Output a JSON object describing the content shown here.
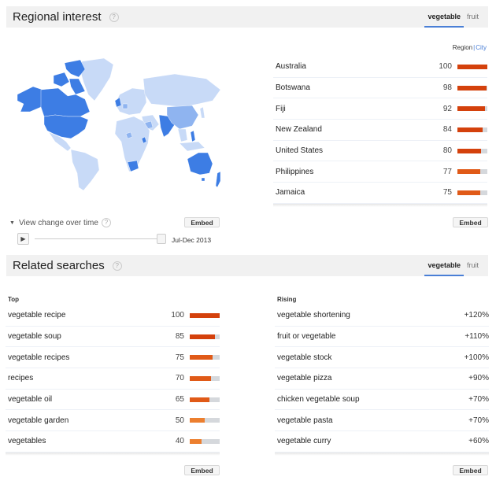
{
  "regional": {
    "title": "Regional interest",
    "help": "?",
    "tabs": [
      {
        "label": "vegetable",
        "active": true
      },
      {
        "label": "fruit",
        "active": false
      }
    ],
    "toggle": {
      "region": "Region",
      "separator": "|",
      "city": "City"
    },
    "rows": [
      {
        "label": "Australia",
        "value": 100
      },
      {
        "label": "Botswana",
        "value": 98
      },
      {
        "label": "Fiji",
        "value": 92
      },
      {
        "label": "New Zealand",
        "value": 84
      },
      {
        "label": "United States",
        "value": 80
      },
      {
        "label": "Philippines",
        "value": 77
      },
      {
        "label": "Jamaica",
        "value": 75
      }
    ],
    "embed": "Embed",
    "map_embed": "Embed",
    "view_change": "View change over time",
    "period": "Jul-Dec 2013",
    "play_icon": "▶",
    "map_colors": {
      "high": "#3d7de4",
      "mid": "#8fb4f0",
      "low": "#c8daf7"
    }
  },
  "related": {
    "title": "Related searches",
    "help": "?",
    "tabs": [
      {
        "label": "vegetable",
        "active": true
      },
      {
        "label": "fruit",
        "active": false
      }
    ],
    "top": {
      "heading": "Top",
      "rows": [
        {
          "label": "vegetable recipe",
          "value": 100
        },
        {
          "label": "vegetable soup",
          "value": 85
        },
        {
          "label": "vegetable recipes",
          "value": 75
        },
        {
          "label": "recipes",
          "value": 70
        },
        {
          "label": "vegetable oil",
          "value": 65
        },
        {
          "label": "vegetable garden",
          "value": 50
        },
        {
          "label": "vegetables",
          "value": 40
        }
      ],
      "embed": "Embed"
    },
    "rising": {
      "heading": "Rising",
      "rows": [
        {
          "label": "vegetable shortening",
          "value": "+120%"
        },
        {
          "label": "fruit or vegetable",
          "value": "+110%"
        },
        {
          "label": "vegetable stock",
          "value": "+100%"
        },
        {
          "label": "vegetable pizza",
          "value": "+90%"
        },
        {
          "label": "chicken vegetable soup",
          "value": "+70%"
        },
        {
          "label": "vegetable pasta",
          "value": "+70%"
        },
        {
          "label": "vegetable curry",
          "value": "+60%"
        }
      ],
      "embed": "Embed"
    }
  },
  "colors": {
    "accent": "#4a7fd6",
    "bar_high": "#d4410c",
    "bar_low": "#ec7f2f",
    "bar_track": "#d5d8dc"
  }
}
